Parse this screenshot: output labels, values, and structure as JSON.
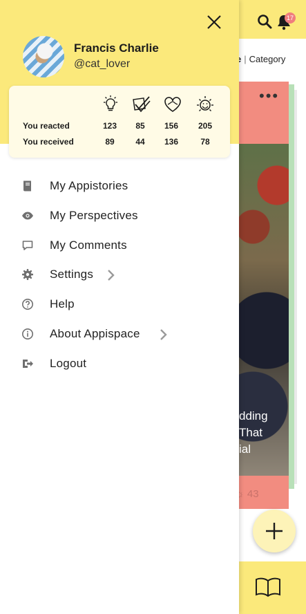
{
  "background": {
    "notification_count": "17",
    "subnav_fragment": "e",
    "subnav_separator": "|",
    "subnav_category": "Category",
    "card_text_lines": [
      "dding",
      "That",
      "ial"
    ],
    "card_reaction_count": "43"
  },
  "profile": {
    "name": "Francis Charlie",
    "handle": "@cat_lover"
  },
  "stats": {
    "reaction_icons": [
      "lightbulb-icon",
      "double-check-icon",
      "heart-icon",
      "sun-face-icon"
    ],
    "rows": [
      {
        "label": "You reacted",
        "values": [
          "123",
          "85",
          "156",
          "205"
        ]
      },
      {
        "label": "You received",
        "values": [
          "89",
          "44",
          "136",
          "78"
        ]
      }
    ]
  },
  "menu": [
    {
      "label": "My Appistories",
      "icon": "book-icon",
      "has_chevron": false
    },
    {
      "label": "My Perspectives",
      "icon": "eye-icon",
      "has_chevron": false
    },
    {
      "label": "My Comments",
      "icon": "comment-icon",
      "has_chevron": false
    },
    {
      "label": "Settings",
      "icon": "gear-icon",
      "has_chevron": true
    },
    {
      "label": "Help",
      "icon": "help-icon",
      "has_chevron": false
    },
    {
      "label": "About Appispace",
      "icon": "info-icon",
      "has_chevron": true
    },
    {
      "label": "Logout",
      "icon": "logout-icon",
      "has_chevron": false
    }
  ],
  "colors": {
    "header_yellow": "#fbe97b",
    "card_salmon": "#f28c80",
    "badge_red": "#f07d7d",
    "fab_cream": "#fdf3b8"
  }
}
